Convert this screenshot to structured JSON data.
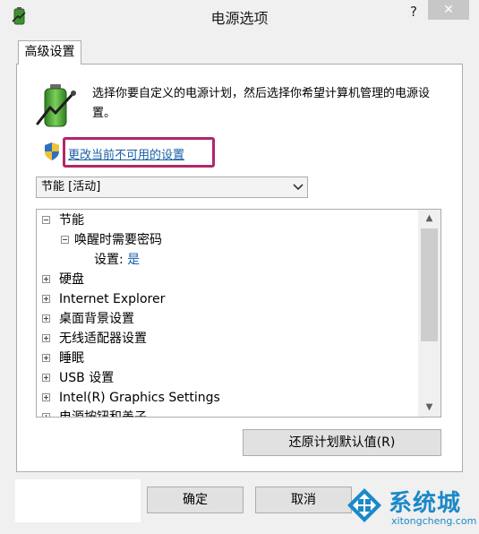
{
  "window": {
    "title": "电源选项",
    "help_label": "?",
    "close_label": "✕"
  },
  "tab": {
    "label": "高级设置"
  },
  "intro": {
    "text": "选择你要自定义的电源计划，然后选择你希望计算机管理的电源设置。"
  },
  "link": {
    "label": "更改当前不可用的设置"
  },
  "plan_select": {
    "value": "节能 [活动]"
  },
  "tree": {
    "items": [
      {
        "label": "节能",
        "expander": "minus"
      },
      {
        "label": "唤醒时需要密码",
        "expander": "minus"
      },
      {
        "label": "设置:",
        "value": "是"
      },
      {
        "label": "硬盘",
        "expander": "plus"
      },
      {
        "label": "Internet Explorer",
        "expander": "plus"
      },
      {
        "label": "桌面背景设置",
        "expander": "plus"
      },
      {
        "label": "无线适配器设置",
        "expander": "plus"
      },
      {
        "label": "睡眠",
        "expander": "plus"
      },
      {
        "label": "USB 设置",
        "expander": "plus"
      },
      {
        "label": "Intel(R) Graphics Settings",
        "expander": "plus"
      },
      {
        "label": "电源按钮和盖子",
        "expander": "plus"
      }
    ]
  },
  "scrollbar": {
    "up_label": "▲",
    "down_label": "▼"
  },
  "buttons": {
    "restore": "还原计划默认值(R)",
    "ok": "确定",
    "cancel": "取消"
  },
  "watermark": {
    "brand": "系统城",
    "url": "xitongcheng.com"
  },
  "colors": {
    "highlight_border": "#b2266a",
    "link": "#1a5ea8",
    "watermark": "#1b89c8"
  }
}
